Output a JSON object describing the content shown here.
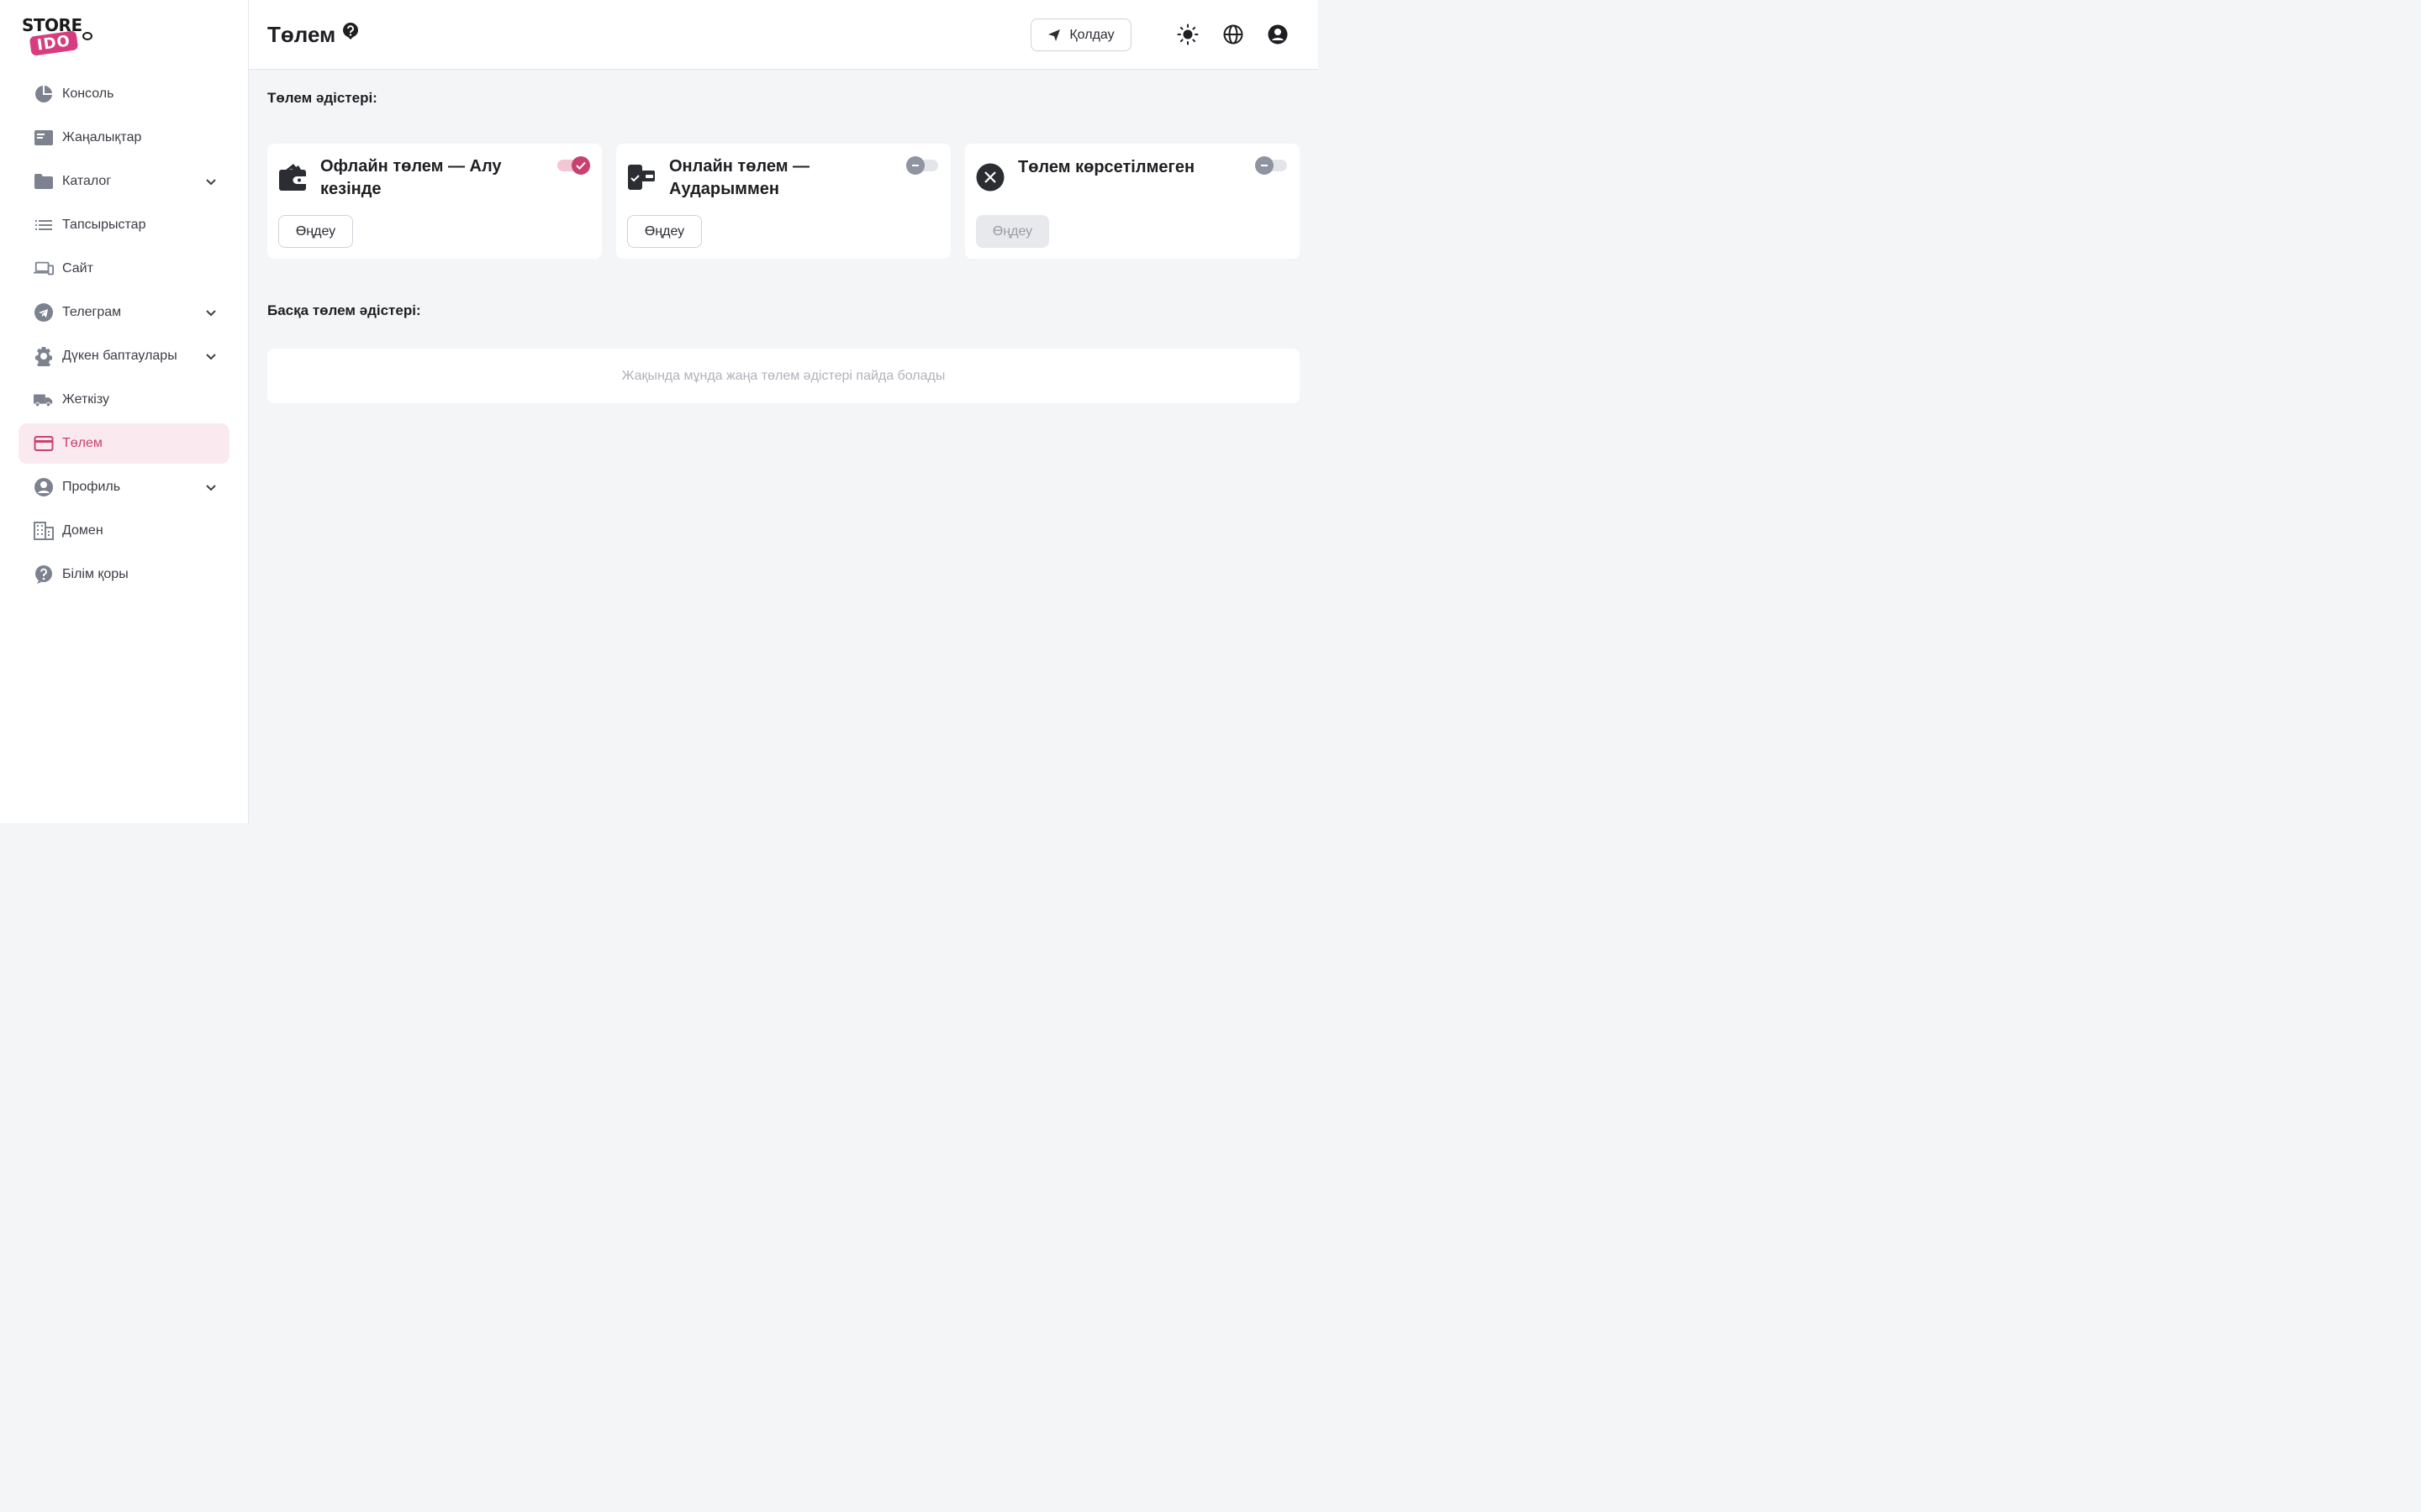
{
  "logo": {
    "line1": "STORE",
    "line2": "IDO"
  },
  "sidebar": {
    "items": [
      {
        "label": "Консоль",
        "icon": "pie-chart-icon",
        "expandable": false
      },
      {
        "label": "Жаңалықтар",
        "icon": "news-icon",
        "expandable": false
      },
      {
        "label": "Каталог",
        "icon": "folder-icon",
        "expandable": true
      },
      {
        "label": "Тапсырыстар",
        "icon": "list-icon",
        "expandable": false
      },
      {
        "label": "Сайт",
        "icon": "devices-icon",
        "expandable": false
      },
      {
        "label": "Телеграм",
        "icon": "telegram-icon",
        "expandable": true
      },
      {
        "label": "Дүкен баптаулары",
        "icon": "gear-icon",
        "expandable": true
      },
      {
        "label": "Жеткізу",
        "icon": "truck-icon",
        "expandable": false
      },
      {
        "label": "Төлем",
        "icon": "credit-card-icon",
        "expandable": false,
        "active": true
      },
      {
        "label": "Профиль",
        "icon": "user-circle-icon",
        "expandable": true
      },
      {
        "label": "Домен",
        "icon": "building-icon",
        "expandable": false
      },
      {
        "label": "Білім қоры",
        "icon": "help-circle-icon",
        "expandable": false
      }
    ]
  },
  "header": {
    "title": "Төлем",
    "support_label": "Қолдау"
  },
  "main": {
    "methods_title": "Төлем әдістері:",
    "other_title": "Басқа төлем әдістері:",
    "other_empty": "Жақында мұнда жаңа төлем әдістері пайда болады",
    "cards": [
      {
        "title": "Офлайн төлем — Алу кезінде",
        "icon": "wallet-icon",
        "enabled": true,
        "edit_label": "Өңдеу",
        "edit_disabled": false
      },
      {
        "title": "Онлайн төлем — Аударыммен",
        "icon": "phone-transfer-icon",
        "enabled": false,
        "edit_label": "Өңдеу",
        "edit_disabled": false
      },
      {
        "title": "Төлем көрсетілмеген",
        "icon": "close-circle-icon",
        "enabled": false,
        "edit_label": "Өңдеу",
        "edit_disabled": true
      }
    ]
  },
  "colors": {
    "accent": "#c8426f",
    "active_bg": "#fbe9f0",
    "icon_gray": "#7d8290"
  }
}
